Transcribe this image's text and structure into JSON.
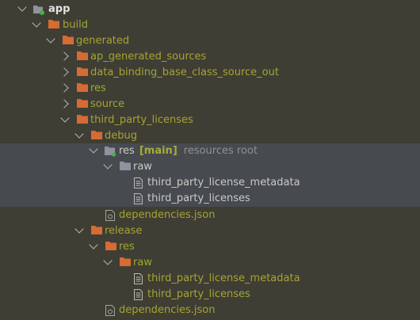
{
  "colors": {
    "background": "#3f3e34",
    "selection": "#474b4f",
    "orange_folder": "#d66b33",
    "grey_folder": "#8d949d",
    "olive_text": "#a3a532",
    "module_icon_dot": "#4caf50"
  },
  "tree": {
    "app": "app",
    "build": "build",
    "generated": "generated",
    "ap_generated_sources": "ap_generated_sources",
    "data_binding": "data_binding_base_class_source_out",
    "res": "res",
    "source": "source",
    "third_party_licenses": "third_party_licenses",
    "debug": "debug",
    "debug_res": "res",
    "debug_res_tag": "[main]",
    "debug_res_hint": "resources root",
    "debug_raw": "raw",
    "debug_metadata": "third_party_license_metadata",
    "debug_licenses": "third_party_licenses",
    "debug_dependencies": "dependencies.json",
    "release": "release",
    "release_res": "res",
    "release_raw": "raw",
    "release_metadata": "third_party_license_metadata",
    "release_licenses": "third_party_licenses",
    "release_dependencies": "dependencies.json"
  }
}
